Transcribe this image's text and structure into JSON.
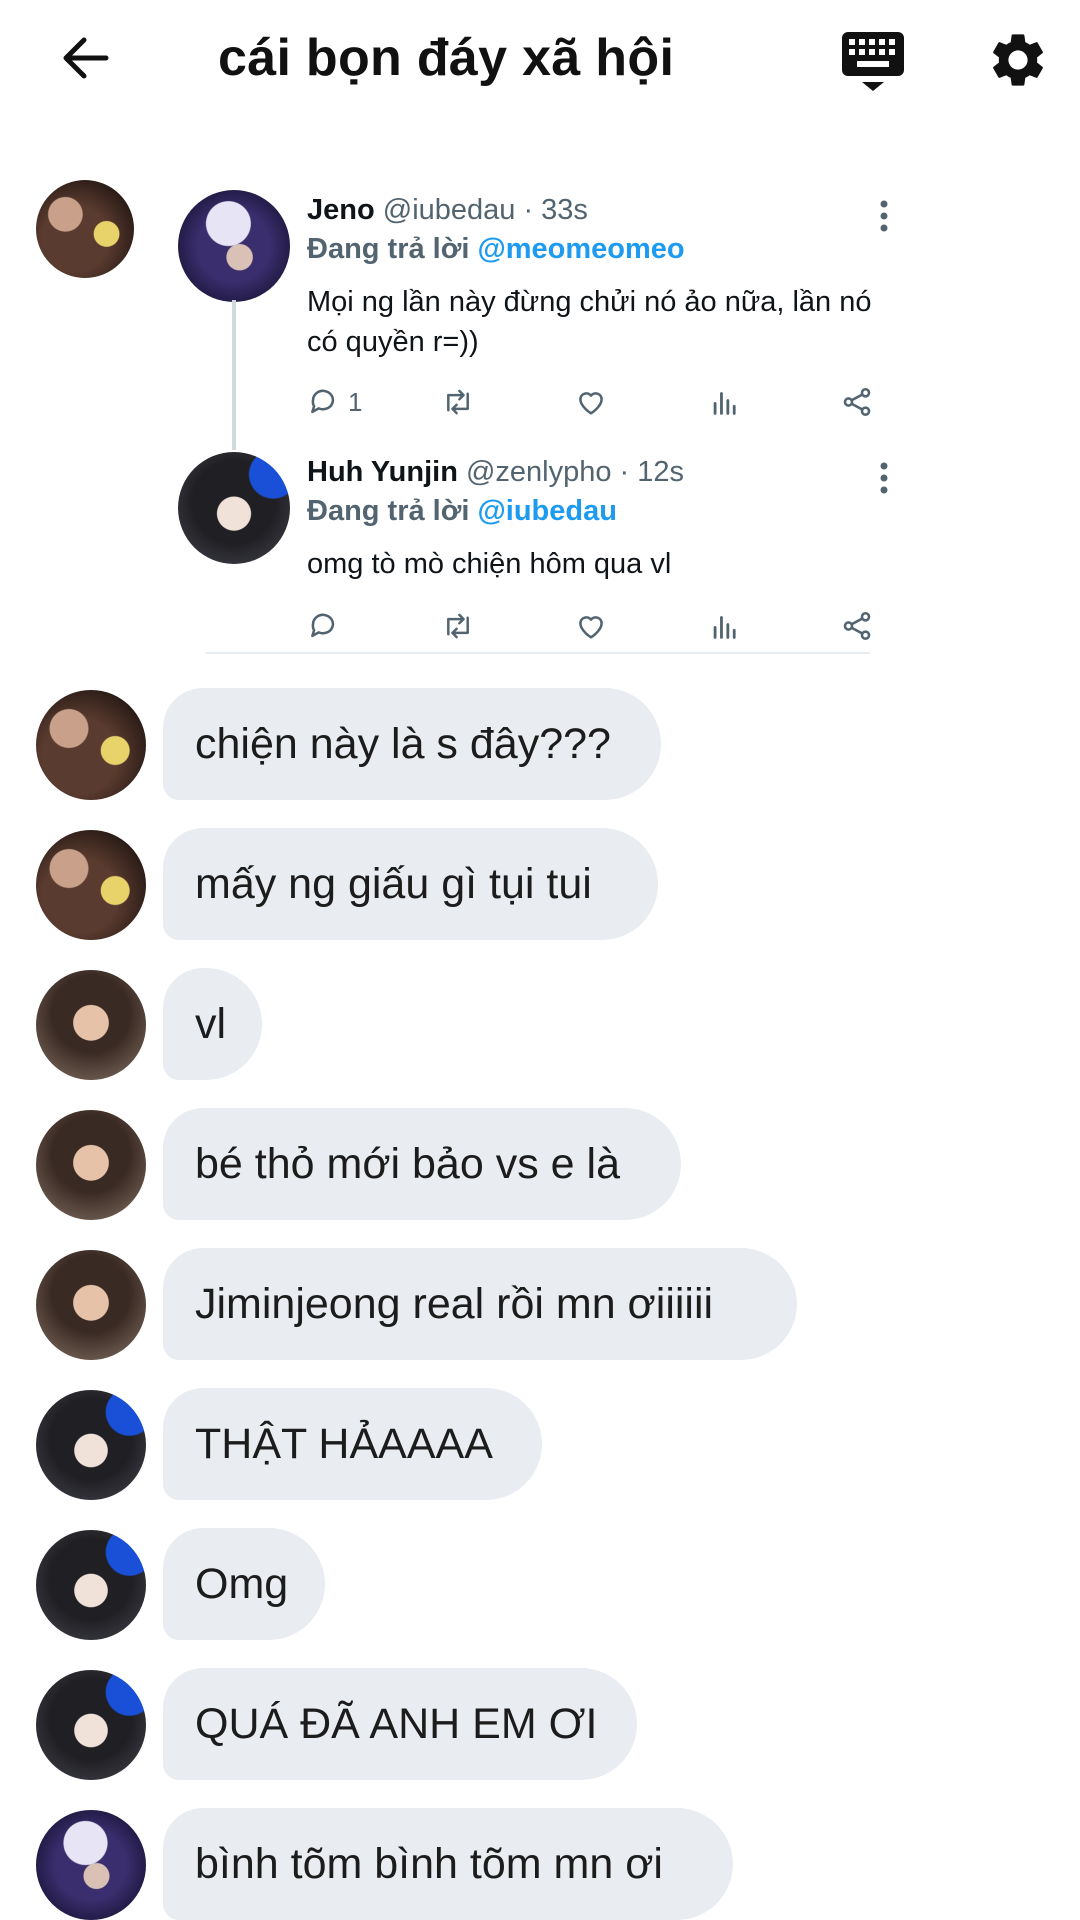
{
  "header": {
    "title": "cái bọn đáy xã hội",
    "icons": {
      "back": "arrow-left-icon",
      "keyboard": "keyboard-icon",
      "settings": "gear-icon"
    }
  },
  "embedded_thread": {
    "tweets": [
      {
        "display_name": "Jeno",
        "handle_time": "@iubedau · 33s",
        "replying_prefix": "Đang trả lời ",
        "replying_to": "@meomeomeo",
        "text": "Mọi ng lần này đừng chửi nó ảo nữa, lần nó có quyền r=))",
        "reply_count": "1"
      },
      {
        "display_name": "Huh Yunjin",
        "handle_time": "@zenlypho · 12s",
        "replying_prefix": "Đang trả lời ",
        "replying_to": "@iubedau",
        "text": "omg tò mò chiện hôm qua vl",
        "reply_count": ""
      }
    ]
  },
  "messages": [
    {
      "text": "chiện này là s đây???"
    },
    {
      "text": "mấy ng giấu gì tụi tui"
    },
    {
      "text": "vl"
    },
    {
      "text": "bé thỏ mới bảo vs e là"
    },
    {
      "text": "Jiminjeong real rồi mn ơiiiiii"
    },
    {
      "text": "THẬT HẢAAAA"
    },
    {
      "text": "Omg"
    },
    {
      "text": "QUÁ ĐÃ ANH EM ƠI"
    },
    {
      "text": "bình tõm bình tõm mn ơi"
    }
  ],
  "colors": {
    "link": "#1d9bf0",
    "bubble": "#e9ecf0",
    "muted": "#536471"
  }
}
